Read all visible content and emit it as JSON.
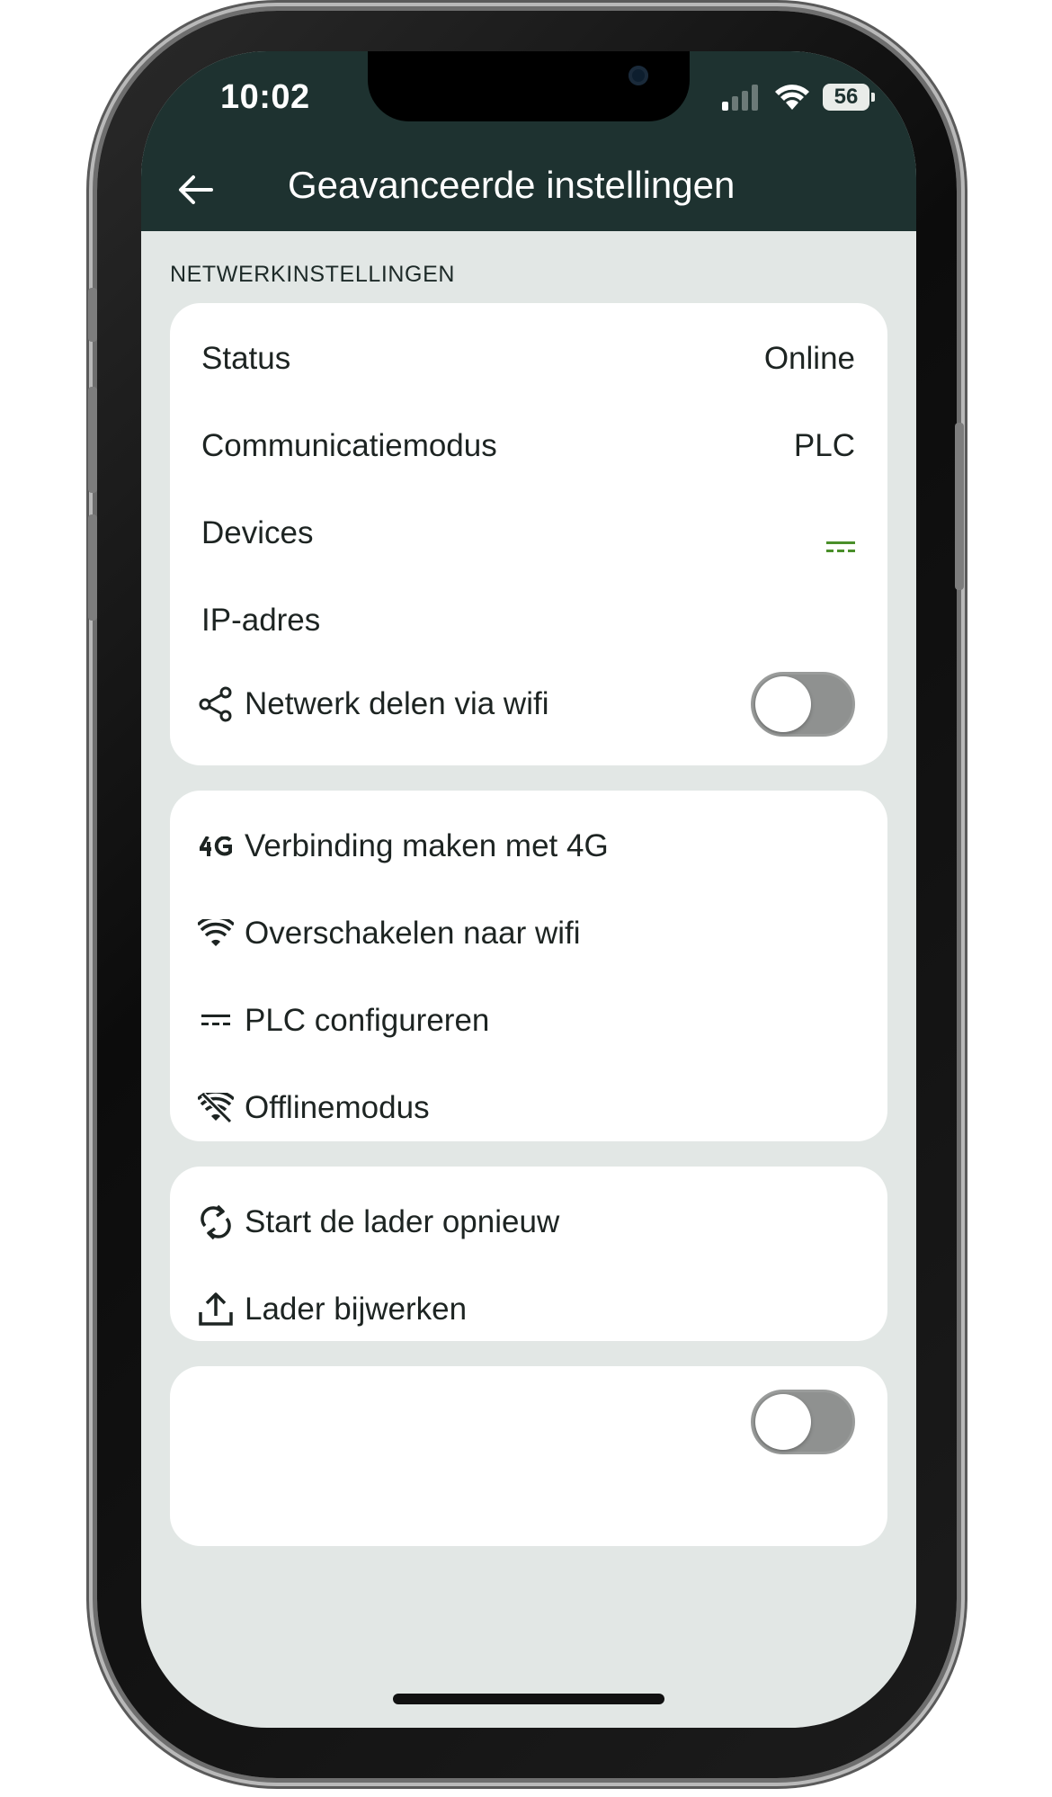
{
  "status_bar": {
    "time": "10:02",
    "battery": "56"
  },
  "header": {
    "title": "Geavanceerde instellingen"
  },
  "network_section": {
    "label": "NETWERKINSTELLINGEN",
    "rows": [
      {
        "label": "Status",
        "value": "Online"
      },
      {
        "label": "Communicatiemodus",
        "value": "PLC"
      },
      {
        "label": "Devices",
        "value_icon": "plc-icon",
        "value_color": "#4a8f2a"
      },
      {
        "label": "IP-adres",
        "value": ""
      },
      {
        "label": "Netwerk delen via wifi",
        "icon": "share-icon",
        "toggle": false
      }
    ]
  },
  "connection_card": {
    "items": [
      {
        "label": "Verbinding maken met 4G",
        "icon": "4g-icon"
      },
      {
        "label": "Overschakelen naar wifi",
        "icon": "wifi-icon"
      },
      {
        "label": "PLC configureren",
        "icon": "plc-icon"
      },
      {
        "label": "Offlinemodus",
        "icon": "wifi-off-icon"
      }
    ]
  },
  "charger_card": {
    "items": [
      {
        "label": "Start de lader opnieuw",
        "icon": "restart-icon"
      },
      {
        "label": "Lader bijwerken",
        "icon": "upload-icon"
      }
    ]
  },
  "colors": {
    "header": "#1e3230",
    "background": "#e2e7e5",
    "accent_green": "#4a8f2a",
    "text": "#1d2422"
  }
}
